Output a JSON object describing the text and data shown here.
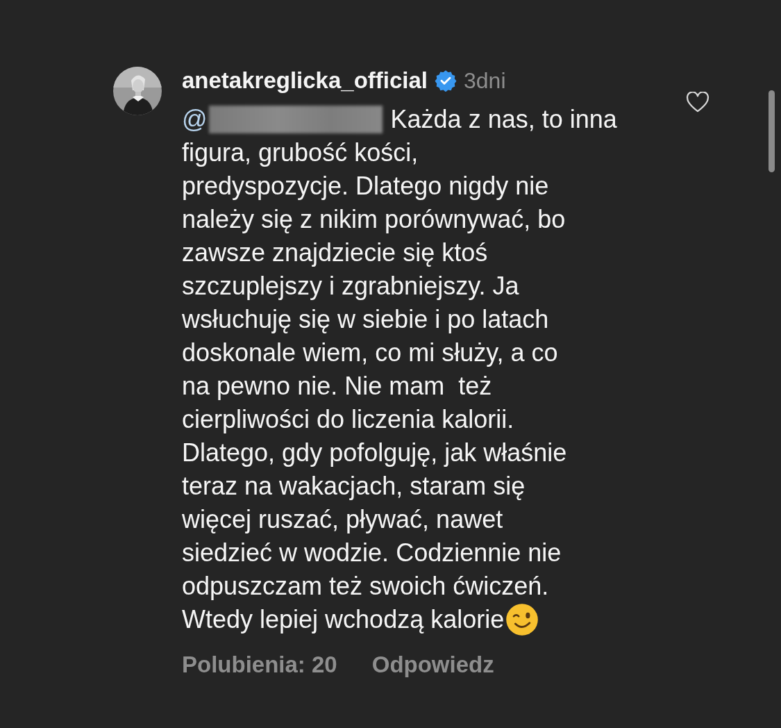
{
  "comment": {
    "username": "anetakreglicka_official",
    "verified": true,
    "time": "3dni",
    "mention_prefix": "@",
    "lines": [
      "Każda z nas, to inna",
      "figura, grubość kości,",
      "predyspozycje. Dlatego nigdy nie",
      "należy się z nikim porównywać, bo",
      "zawsze znajdziecie się ktoś",
      "szczuplejszy i zgrabniejszy. Ja",
      "wsłuchuję się w siebie i po latach",
      "doskonale wiem, co mi służy, a co",
      "na pewno nie. Nie mam  też",
      "cierpliwości do liczenia kalorii.",
      "Dlatego, gdy pofolguję, jak właśnie",
      "teraz na wakacjach, staram się",
      "więcej ruszać, pływać, nawet",
      "siedzieć w wodzie. Codziennie nie",
      "odpuszczam też swoich ćwiczeń.",
      "Wtedy lepiej wchodzą kalorie"
    ],
    "liked": false,
    "likes": "Polubienia: 20",
    "reply": "Odpowiedz"
  }
}
